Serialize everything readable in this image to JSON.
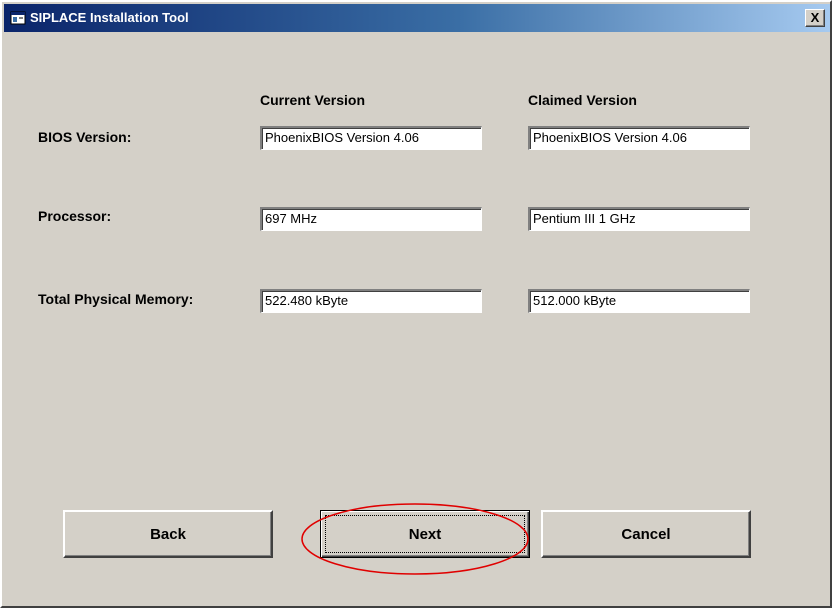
{
  "window": {
    "title": "SIPLACE Installation Tool",
    "close_label": "X"
  },
  "columns": {
    "current": "Current Version",
    "claimed": "Claimed Version"
  },
  "rows": [
    {
      "label": "BIOS Version:",
      "current": "PhoenixBIOS Version 4.06",
      "claimed": "PhoenixBIOS Version  4.06"
    },
    {
      "label": "Processor:",
      "current": "697 MHz",
      "claimed": "Pentium III 1 GHz"
    },
    {
      "label": "Total Physical Memory:",
      "current": "522.480 kByte",
      "claimed": "512.000 kByte"
    }
  ],
  "buttons": {
    "back": "Back",
    "next": "Next",
    "cancel": "Cancel"
  },
  "colors": {
    "title_bar_start": "#0a246a",
    "title_bar_end": "#a6caf0",
    "face": "#d4d0c8",
    "highlight_ellipse": "#e00000"
  },
  "icons": {
    "title": "app-window-icon"
  }
}
